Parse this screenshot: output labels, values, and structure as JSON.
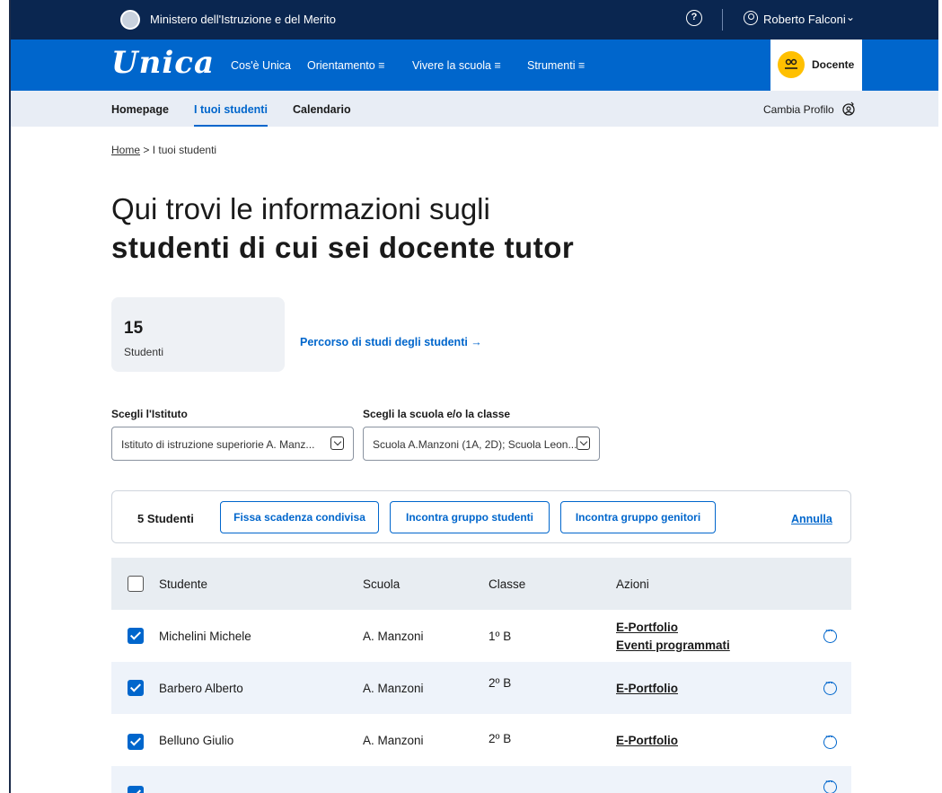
{
  "topbar": {
    "ministry": "Ministero dell'Istruzione e del Merito",
    "help_icon": "question-circle-icon",
    "user_name": "Roberto Falconi",
    "user_icon": "user-circle-icon",
    "chevron": "chevron-down-icon"
  },
  "mainnav": {
    "logo": "Unica",
    "links": [
      "Cos'è Unica",
      "Orientamento ≡",
      "Vivere la scuola ≡",
      "Strumenti ≡"
    ],
    "profile_label": "Docente",
    "profile_icon": "teacher-icon"
  },
  "subnav": {
    "items": [
      "Homepage",
      "I tuoi studenti",
      "Calendario"
    ],
    "active": "I tuoi studenti",
    "cambia_profilo": "Cambia Profilo",
    "cambia_icon": "switch-profile-icon"
  },
  "breadcrumb": {
    "home": "Home",
    "separator": ">",
    "current": "I tuoi studenti"
  },
  "heading": {
    "line1": "Qui trovi le informazioni sugli",
    "line2": "studenti di cui sei docente tutor"
  },
  "stats": {
    "count": "15",
    "label": "Studenti",
    "percorso_link": "Percorso di studi degli studenti →"
  },
  "filters": {
    "istituto_label": "Scegli l'Istituto",
    "istituto_value": "Istituto di istruzione superiorie A. Manz...",
    "scuola_label": "Scegli la scuola e/o la classe",
    "scuola_value": "Scuola A.Manzoni (1A, 2D); Scuola Leon..."
  },
  "actionbar": {
    "selected": "5 Studenti",
    "btn_scadenza": "Fissa scadenza condivisa",
    "btn_studenti": "Incontra gruppo studenti",
    "btn_genitori": "Incontra gruppo genitori",
    "annulla": "Annulla"
  },
  "table": {
    "headers": [
      "Studente",
      "Scuola",
      "Classe",
      "Azioni"
    ],
    "rows": [
      {
        "name": "Michelini Michele",
        "school": "A. Manzoni",
        "class": "1º B",
        "action1": "E-Portfolio",
        "action2": "Eventi programmati",
        "checked": true
      },
      {
        "name": "Barbero Alberto",
        "school": "A. Manzoni",
        "class": "2º B",
        "action1": "E-Portfolio",
        "action2": "",
        "checked": true
      },
      {
        "name": "Belluno Giulio",
        "school": "A. Manzoni",
        "class": "2º B",
        "action1": "E-Portfolio",
        "action2": "",
        "checked": true
      },
      {
        "name": "",
        "school": "",
        "class": "",
        "action1": "",
        "action2": "",
        "checked": true
      }
    ]
  },
  "colors": {
    "primary": "#0066cc",
    "dark_navy": "#0a2650",
    "profile_badge": "#ffc000",
    "row_alt": "#eef3fa"
  }
}
